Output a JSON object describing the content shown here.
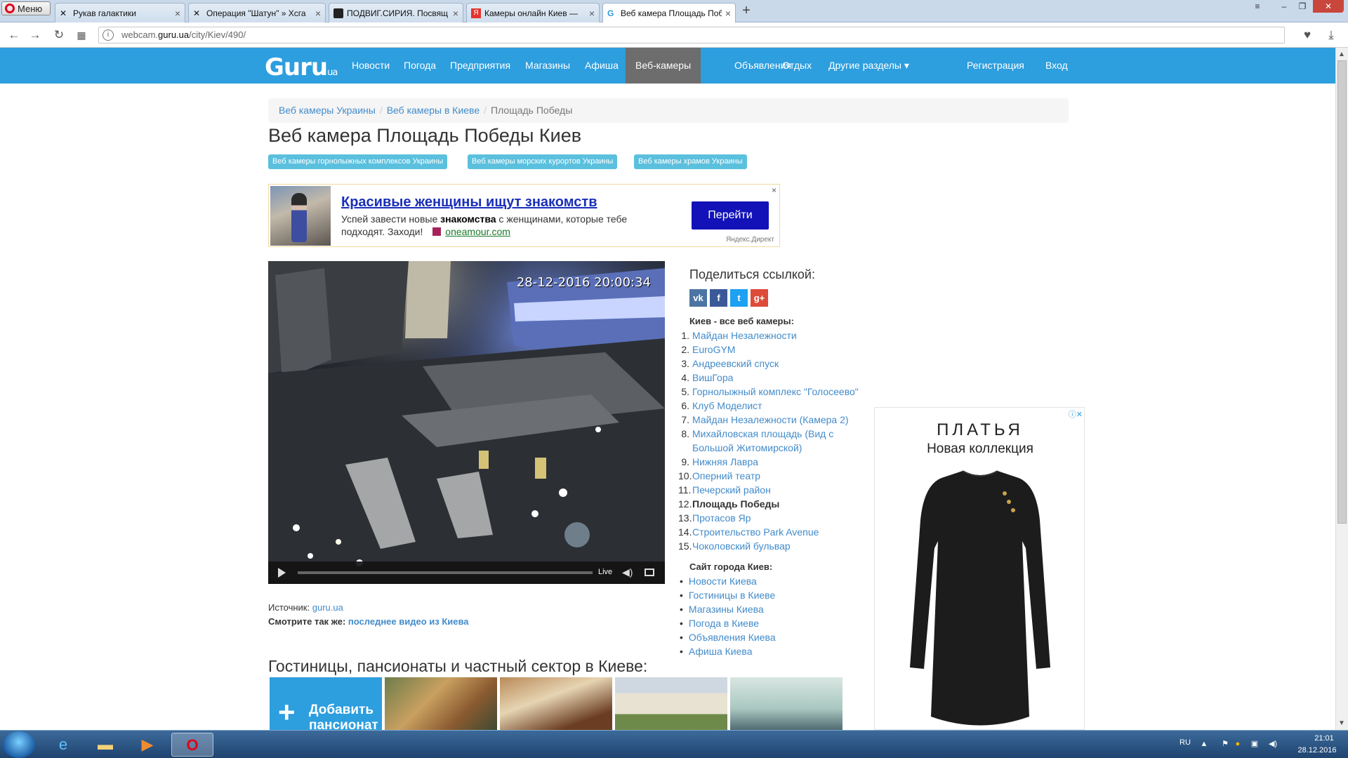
{
  "browser": {
    "menu_label": "Меню",
    "tabs": [
      {
        "title": "Рукав галактики"
      },
      {
        "title": "Операция \"Шатун\" » Хсга"
      },
      {
        "title": "ПОДВИГ.СИРИЯ. Посвящ"
      },
      {
        "title": "Камеры онлайн Киев — "
      },
      {
        "title": "Веб камера Площадь Поб"
      }
    ],
    "url_prefix": "webcam.",
    "url_domain": "guru.ua",
    "url_path": "/city/Kiev/490/"
  },
  "site": {
    "logo": "Guru",
    "logo_suffix": "ua",
    "nav": [
      "Новости",
      "Погода",
      "Предприятия",
      "Магазины",
      "Афиша",
      "Веб-камеры",
      "Объявления",
      "Отдых",
      "Другие разделы ▾"
    ],
    "register": "Регистрация",
    "login": "Вход"
  },
  "breadcrumb": [
    "Веб камеры Украины",
    "Веб камеры в Киеве",
    "Площадь Победы"
  ],
  "page_title": "Веб камера Площадь Победы Киев",
  "tags": [
    "Веб камеры горнолыжных комплексов Украины",
    "Веб камеры морских курортов Украины",
    "Веб камеры храмов Украины"
  ],
  "ad_top": {
    "title": "Красивые женщины ищут знакомств",
    "text_before": "Успей завести новые ",
    "text_bold": "знакомства",
    "text_after": " с женщинами, которые тебе подходят. Заходи!",
    "domain": "oneamour.com",
    "button": "Перейти",
    "source": "Яндекс.Директ",
    "close": "×"
  },
  "video": {
    "timestamp": "28-12-2016 20:00:34",
    "live_label": "Live"
  },
  "source_label": "Источник:",
  "source_link": "guru.ua",
  "see_also_label": "Смотрите так же:",
  "see_also_link": "последнее видео из Киева",
  "share": {
    "title": "Поделиться ссылкой:",
    "icons": [
      "vk-icon",
      "facebook-icon",
      "twitter-icon",
      "google-plus-icon"
    ]
  },
  "cams": {
    "title": "Киев - все веб камеры:",
    "items": [
      "Майдан Незалежности",
      "EuroGYM",
      "Андреевский спуск",
      "ВишГора",
      "Горнолыжный комплекс \"Голосеево\"",
      "Клуб Моделист",
      "Майдан Незалежности (Камера 2)",
      "Михайловская площадь (Вид с Большой Житомирской)",
      "Нижняя Лавра",
      "Оперний театр",
      "Печерский район",
      "Площадь Победы",
      "Протасов Яр",
      "Строительство Park Avenue",
      "Чоколовский бульвар"
    ],
    "current_index": 11
  },
  "city_site": {
    "title": "Сайт города Киев:",
    "items": [
      "Новости Киева",
      "Гостиницы в Киеве",
      "Магазины Киева",
      "Погода в Киеве",
      "Объявления Киева",
      "Афиша Киева"
    ]
  },
  "hotels": {
    "title": "Гостиницы, пансионаты и частный сектор в Киеве:",
    "add_label": "Добавить пансионат"
  },
  "ad_right": {
    "title": "ПЛАТЬЯ",
    "subtitle": "Новая коллекция"
  },
  "taskbar": {
    "lang": "RU",
    "time": "21:01",
    "date": "28.12.2016"
  },
  "colors": {
    "nav_bg": "#2d9ede",
    "nav_active": "#6d6d6d",
    "link": "#428bca",
    "tag_bg": "#5bc0de",
    "ad_button": "#1212b8"
  }
}
